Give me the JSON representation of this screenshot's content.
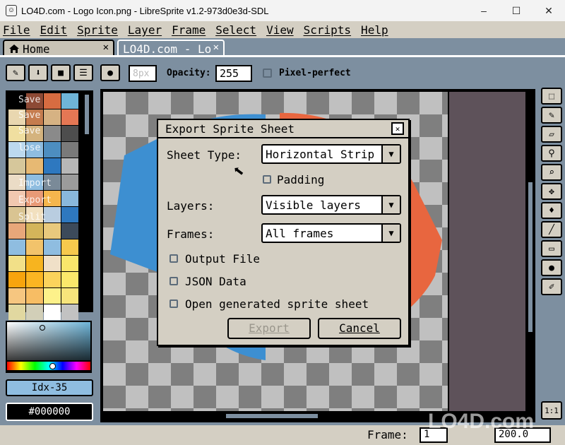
{
  "window": {
    "title": "LO4D.com - Logo Icon.png - LibreSprite v1.2-973d0e3d-SDL",
    "app_icon": "☺",
    "minimize": "–",
    "maximize": "☐",
    "close": "✕"
  },
  "menu": [
    "File",
    "Edit",
    "Sprite",
    "Layer",
    "Frame",
    "Select",
    "View",
    "Scripts",
    "Help"
  ],
  "tabs": {
    "home": "Home",
    "active": "LO4D.com - Lo",
    "close_glyph": "✕"
  },
  "toolbar": {
    "brush_size": "8px",
    "opacity_label": "Opacity:",
    "opacity_value": "255",
    "pixel_perfect_label": "Pixel-perfect"
  },
  "palette": {
    "colors": [
      "#000000",
      "#8d4a35",
      "#d66c41",
      "#6fb5d8",
      "#e9d7b0",
      "#c57c4e",
      "#d6b283",
      "#e47754",
      "#f0dfa0",
      "#d4b37e",
      "#8a8a8a",
      "#4d4d4d",
      "#bcd9ee",
      "#8fbde0",
      "#4d8ec0",
      "#7a7a7a",
      "#d6c79b",
      "#e7b973",
      "#2e78bf",
      "#b7b7b7",
      "#ebdcc6",
      "#8fbde0",
      "#7a8a98",
      "#9b9b9b",
      "#f1c8b0",
      "#e89a77",
      "#f5b64d",
      "#89b8dc",
      "#d9c492",
      "#f2e0bf",
      "#b9cde0",
      "#2e78bf",
      "#e8a77a",
      "#d4b55a",
      "#e8c97d",
      "#3c4a5a",
      "#8fbde0",
      "#f2c36b",
      "#8fbde0",
      "#f6c94d",
      "#f2e088",
      "#f7b41f",
      "#f0e0c8",
      "#f9e66b",
      "#f7a40d",
      "#fbb522",
      "#fbd35c",
      "#fbe96b",
      "#f6c680",
      "#f7bd64",
      "#fdf18a",
      "#f7e47b",
      "#e1d8a0",
      "#d2cfb8",
      "#ffffff",
      "#c2c2c2"
    ],
    "context_items": [
      "Save",
      "Save",
      "Save",
      "lose",
      "Import",
      "Export",
      "Split"
    ]
  },
  "color": {
    "index": "Idx-35",
    "hex": "#000000"
  },
  "dialog": {
    "title": "Export Sprite Sheet",
    "sheet_type_label": "Sheet Type:",
    "sheet_type_value": "Horizontal Strip",
    "padding_label": "Padding",
    "layers_label": "Layers:",
    "layers_value": "Visible layers",
    "frames_label": "Frames:",
    "frames_value": "All frames",
    "output_file_label": "Output File",
    "json_data_label": "JSON Data",
    "open_sheet_label": "Open generated sprite sheet",
    "export_button": "Export",
    "cancel_button": "Cancel"
  },
  "status": {
    "frame_label": "Frame:",
    "frame_value": "1",
    "zoom_value": "200.0"
  },
  "one_to_one": "1:1",
  "watermark": "LO4D.com",
  "colors": {
    "ui_bg": "#7d8fa0",
    "panel": "#d4cfc3",
    "logo_blue": "#3d8fd1",
    "logo_orange": "#e8663f"
  }
}
